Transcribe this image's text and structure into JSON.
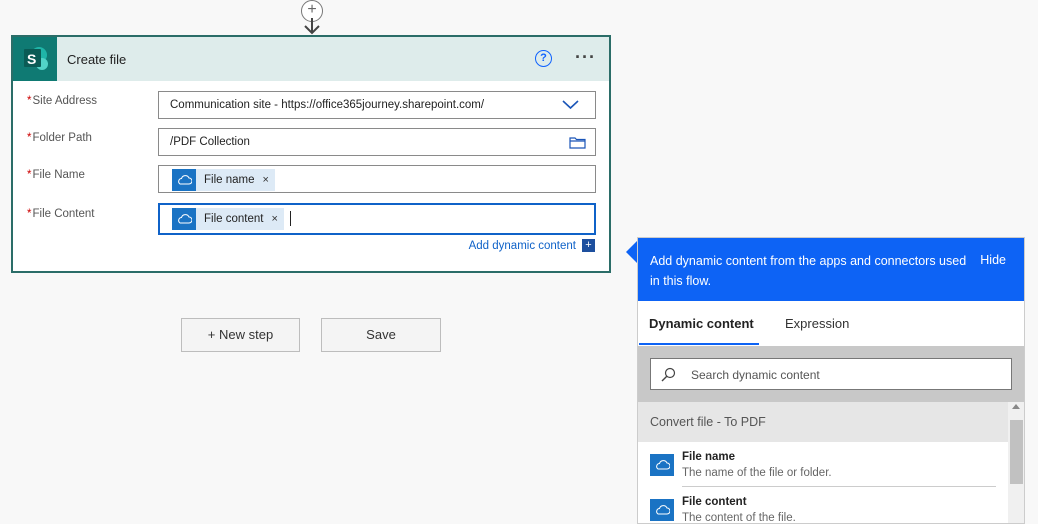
{
  "card": {
    "title": "Create file",
    "help_glyph": "?",
    "more_glyph": "···",
    "fields": [
      {
        "label": "Site Address",
        "required_mark": "*",
        "value": "Communication site - https://office365journey.sharepoint.com/"
      },
      {
        "label": "Folder Path",
        "required_mark": "*",
        "value": "/PDF Collection"
      },
      {
        "label": "File Name",
        "required_mark": "*",
        "token": "File name",
        "remove_glyph": "×"
      },
      {
        "label": "File Content",
        "required_mark": "*",
        "token": "File content",
        "remove_glyph": "×"
      }
    ],
    "add_dynamic_content": "Add dynamic content",
    "add_dynamic_glyph": "+"
  },
  "actions": {
    "new_step": "+ New step",
    "save": "Save",
    "insert_glyph": "+"
  },
  "panel": {
    "header_text": "Add dynamic content from the apps and connectors used in this flow.",
    "hide_label": "Hide",
    "tabs": [
      "Dynamic content",
      "Expression"
    ],
    "active_tab": "Dynamic content",
    "search_placeholder": "Search dynamic content",
    "group_title": "Convert file - To PDF",
    "items": [
      {
        "title": "File name",
        "description": "The name of the file or folder."
      },
      {
        "title": "File content",
        "description": "The content of the file."
      }
    ]
  },
  "colors": {
    "accent": "#0d63f5",
    "sharepoint": "#0f7a73",
    "token": "#1a73c4",
    "card_border": "#2b6d68"
  },
  "icons": [
    "add-step-icon",
    "sharepoint-icon",
    "help-icon",
    "more-icon",
    "chevron-down-icon",
    "folder-icon",
    "onedrive-icon",
    "search-icon"
  ]
}
